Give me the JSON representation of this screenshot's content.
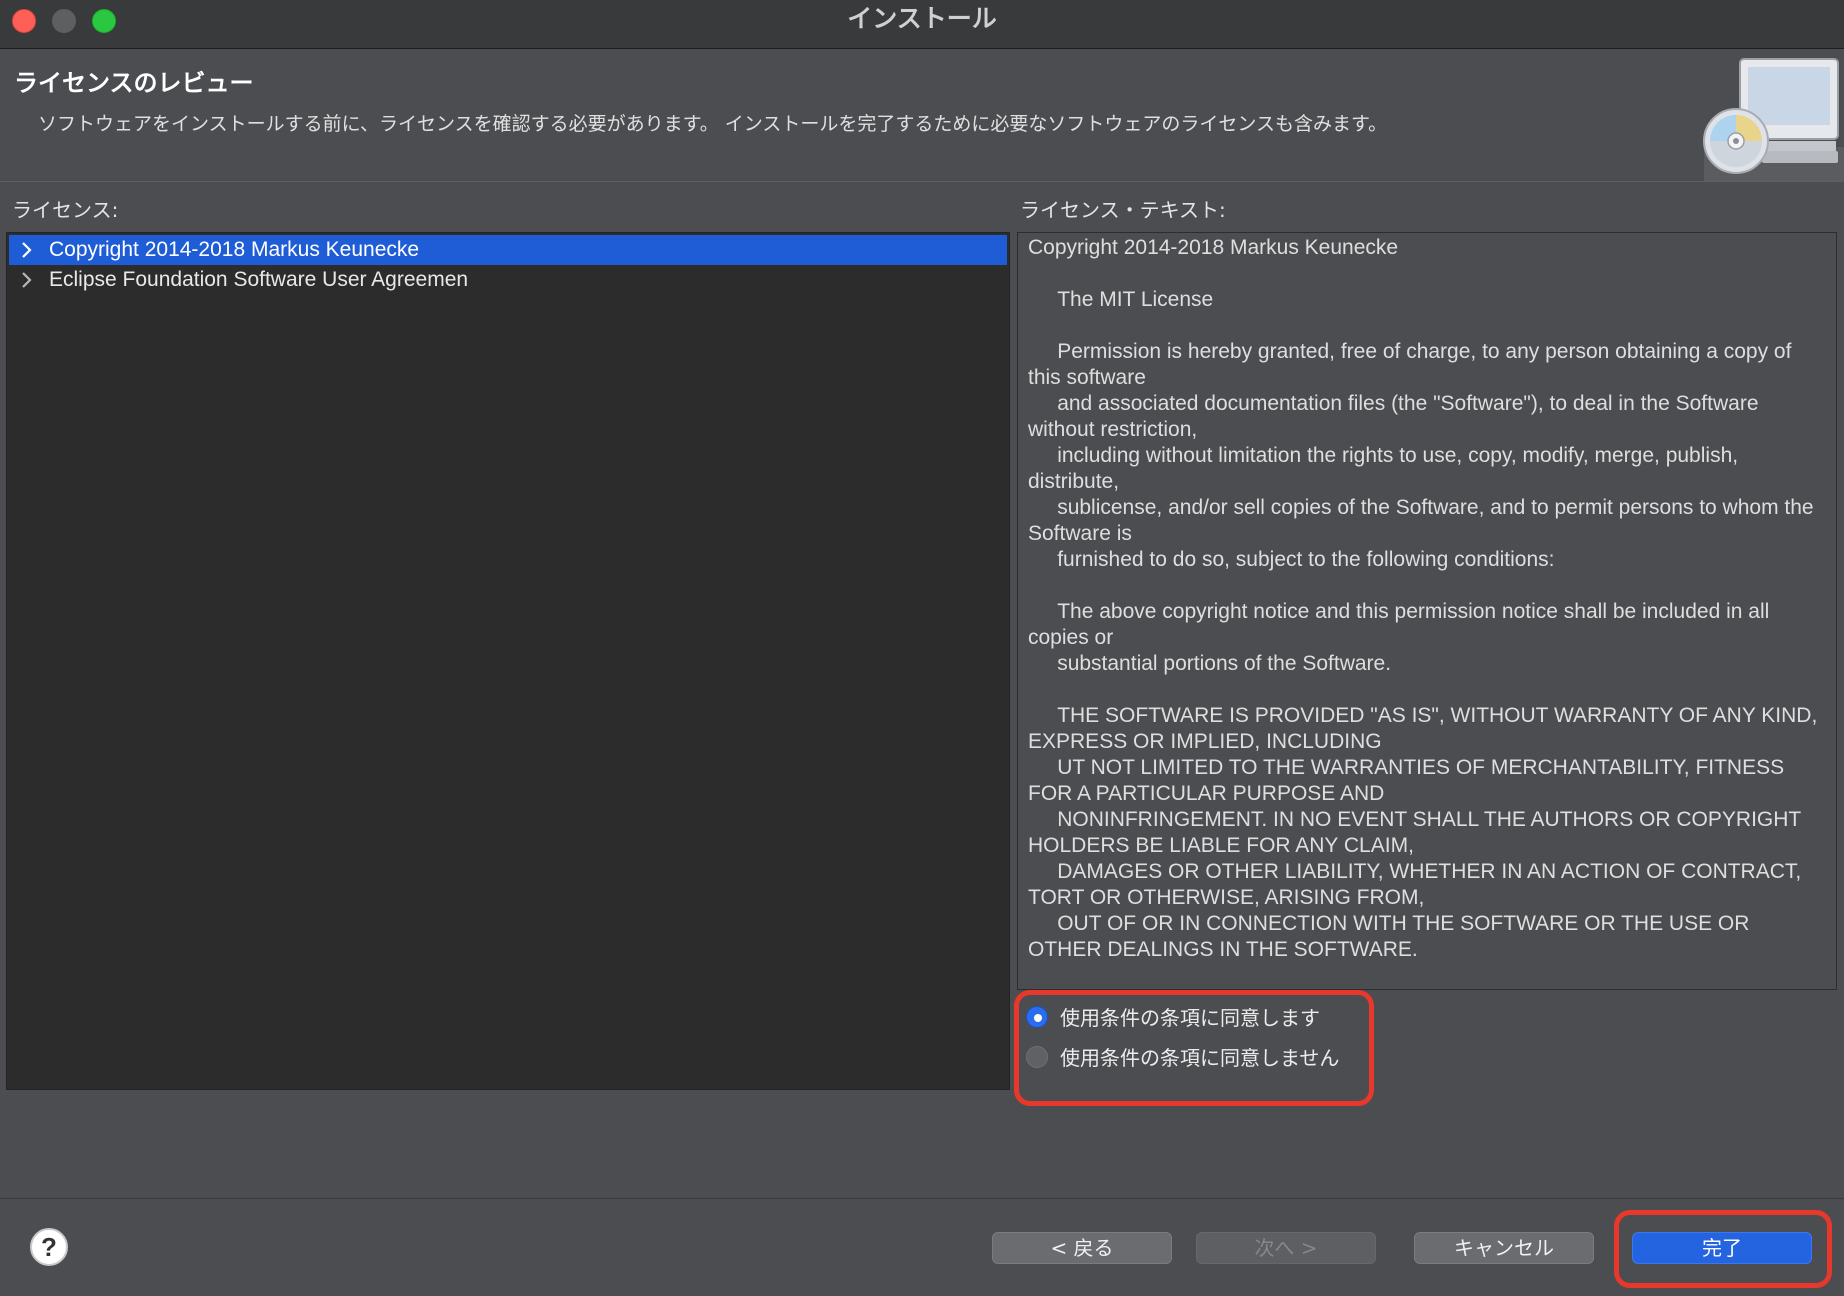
{
  "window": {
    "title": "インストール"
  },
  "header": {
    "title": "ライセンスのレビュー",
    "description": "ソフトウェアをインストールする前に、ライセンスを確認する必要があります。 インストールを完了するために必要なソフトウェアのライセンスも含みます。",
    "icon": "install-cd-monitor-icon"
  },
  "licenses": {
    "label": "ライセンス:",
    "items": [
      {
        "label": "Copyright 2014-2018 Markus Keunecke",
        "selected": true
      },
      {
        "label": "Eclipse Foundation Software User Agreemen",
        "selected": false
      }
    ]
  },
  "license_text": {
    "label": "ライセンス・テキスト:",
    "body": "Copyright 2014-2018 Markus Keunecke\n\n     The MIT License\n\n     Permission is hereby granted, free of charge, to any person obtaining a copy of this software\n     and associated documentation files (the \"Software\"), to deal in the Software without restriction,\n     including without limitation the rights to use, copy, modify, merge, publish, distribute,\n     sublicense, and/or sell copies of the Software, and to permit persons to whom the Software is\n     furnished to do so, subject to the following conditions:\n\n     The above copyright notice and this permission notice shall be included in all copies or\n     substantial portions of the Software.\n\n     THE SOFTWARE IS PROVIDED \"AS IS\", WITHOUT WARRANTY OF ANY KIND, EXPRESS OR IMPLIED, INCLUDING\n     UT NOT LIMITED TO THE WARRANTIES OF MERCHANTABILITY, FITNESS FOR A PARTICULAR PURPOSE AND\n     NONINFRINGEMENT. IN NO EVENT SHALL THE AUTHORS OR COPYRIGHT HOLDERS BE LIABLE FOR ANY CLAIM,\n     DAMAGES OR OTHER LIABILITY, WHETHER IN AN ACTION OF CONTRACT, TORT OR OTHERWISE, ARISING FROM,\n     OUT OF OR IN CONNECTION WITH THE SOFTWARE OR THE USE OR OTHER DEALINGS IN THE SOFTWARE."
  },
  "agreement": {
    "accept_label": "使用条件の条項に同意します",
    "decline_label": "使用条件の条項に同意しません",
    "selected": "accept"
  },
  "buttons": {
    "help_label": "?",
    "back_label": "< 戻る",
    "next_label": "次へ >",
    "cancel_label": "キャンセル",
    "finish_label": "完了"
  },
  "colors": {
    "selection": "#1f5dd6",
    "highlight": "#e8382c",
    "primary_button": "#2464e0"
  }
}
